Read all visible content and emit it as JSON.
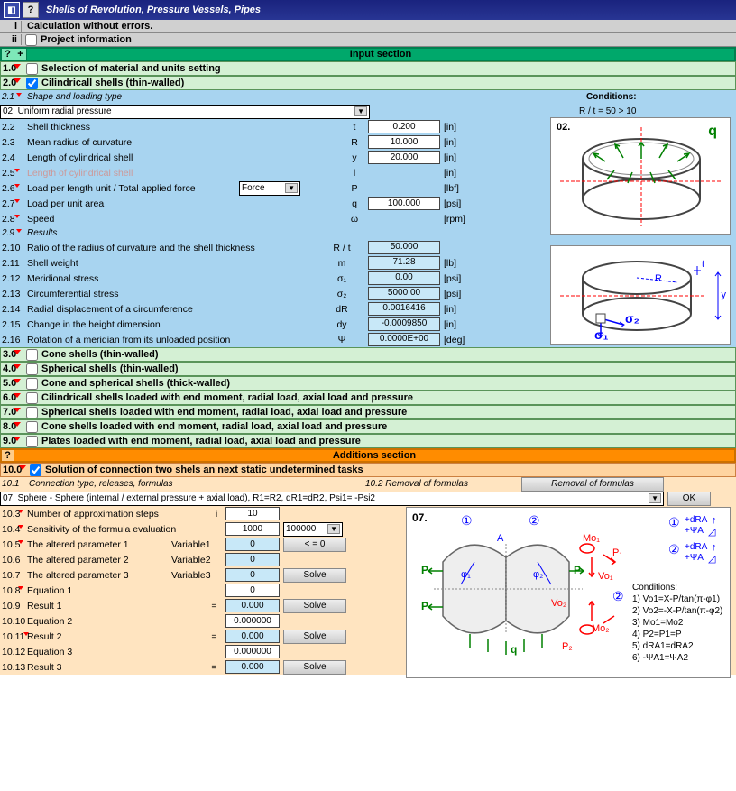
{
  "title": "Shells of Revolution, Pressure Vessels, Pipes",
  "status": {
    "i": "i",
    "i_text": "Calculation without errors.",
    "ii": "ii",
    "ii_text": "Project information"
  },
  "input_section": {
    "q": "?",
    "plus": "+",
    "title": "Input section"
  },
  "s1": {
    "num": "1.0",
    "label": "Selection of material and units setting"
  },
  "s2": {
    "num": "2.0",
    "label": "Cilindricall shells (thin-walled)",
    "r2_1": {
      "num": "2.1",
      "label": "Shape and loading type"
    },
    "conditions_label": "Conditions:",
    "conditions_text": "R / t = 50 > 10",
    "diagram_num": "02.",
    "diagram_q": "q",
    "dropdown": "02. Uniform radial pressure",
    "r2_2": {
      "num": "2.2",
      "label": "Shell thickness",
      "sym": "t",
      "val": "0.200",
      "unit": "[in]"
    },
    "r2_3": {
      "num": "2.3",
      "label": "Mean radius of curvature",
      "sym": "R",
      "val": "10.000",
      "unit": "[in]"
    },
    "r2_4": {
      "num": "2.4",
      "label": "Length of cylindrical shell",
      "sym": "y",
      "val": "20.000",
      "unit": "[in]"
    },
    "r2_5": {
      "num": "2.5",
      "label": "Length of cylindrical shell",
      "sym": "l",
      "unit": "[in]"
    },
    "r2_6": {
      "num": "2.6",
      "label": "Load per length unit / Total applied force",
      "dd": "Force",
      "sym": "P",
      "unit": "[lbf]"
    },
    "r2_7": {
      "num": "2.7",
      "label": "Load per unit area",
      "sym": "q",
      "val": "100.000",
      "unit": "[psi]"
    },
    "r2_8": {
      "num": "2.8",
      "label": "Speed",
      "sym": "ω",
      "unit": "[rpm]"
    },
    "r2_9": {
      "num": "2.9",
      "label": "Results"
    },
    "r2_10": {
      "num": "2.10",
      "label": "Ratio of the radius of curvature and the shell thickness",
      "sym": "R / t",
      "val": "50.000"
    },
    "r2_11": {
      "num": "2.11",
      "label": "Shell weight",
      "sym": "m",
      "val": "71.28",
      "unit": "[lb]"
    },
    "r2_12": {
      "num": "2.12",
      "label": "Meridional stress",
      "sym": "σ₁",
      "val": "0.00",
      "unit": "[psi]"
    },
    "r2_13": {
      "num": "2.13",
      "label": "Circumferential stress",
      "sym": "σ₂",
      "val": "5000.00",
      "unit": "[psi]"
    },
    "r2_14": {
      "num": "2.14",
      "label": "Radial displacement of a circumference",
      "sym": "dR",
      "val": "0.0016416",
      "unit": "[in]"
    },
    "r2_15": {
      "num": "2.15",
      "label": "Change in the height dimension",
      "sym": "dy",
      "val": "-0.0009850",
      "unit": "[in]"
    },
    "r2_16": {
      "num": "2.16",
      "label": "Rotation of a meridian from its unloaded position",
      "sym": "Ψ",
      "val": "0.0000E+00",
      "unit": "[deg]"
    },
    "diag2_sigma1": "σ₁",
    "diag2_sigma2": "σ₂",
    "diag2_t": "t",
    "diag2_R": "R",
    "diag2_y": "y"
  },
  "s3": {
    "num": "3.0",
    "label": "Cone shells (thin-walled)"
  },
  "s4": {
    "num": "4.0",
    "label": "Spherical shells (thin-walled)"
  },
  "s5": {
    "num": "5.0",
    "label": "Cone and spherical shells (thick-walled)"
  },
  "s6": {
    "num": "6.0",
    "label": "Cilindricall shells loaded with end moment, radial load, axial load and pressure"
  },
  "s7": {
    "num": "7.0",
    "label": "Spherical shells loaded with end moment, radial load, axial load and pressure"
  },
  "s8": {
    "num": "8.0",
    "label": "Cone shells loaded with end moment, radial load, axial load and pressure"
  },
  "s9": {
    "num": "9.0",
    "label": "Plates loaded with end moment, radial load, axial load and pressure"
  },
  "additions_section": {
    "q": "?",
    "title": "Additions section"
  },
  "s10": {
    "num": "10.0",
    "label": "Solution of connection two shels an next static undetermined tasks",
    "r10_1": {
      "num": "10.1",
      "label": "Connection type, releases, formulas"
    },
    "r10_2": {
      "num": "10.2",
      "label": "Removal of formulas"
    },
    "btn_removal": "Removal  of formulas",
    "dropdown": "07. Sphere - Sphere (internal / external pressure + axial load), R1=R2, dR1=dR2, Psi1= -Psi2",
    "btn_ok": "OK",
    "r10_3": {
      "num": "10.3",
      "label": "Number of approximation steps",
      "sym": "i",
      "val": "10"
    },
    "r10_4": {
      "num": "10.4",
      "label": "Sensitivity of the formula evaluation",
      "val": "1000",
      "dd": "100000"
    },
    "r10_5": {
      "num": "10.5",
      "label": "The altered parameter 1",
      "sym": "Variable1",
      "val": "0",
      "btn": "< = 0"
    },
    "r10_6": {
      "num": "10.6",
      "label": "The altered parameter 2",
      "sym": "Variable2",
      "val": "0"
    },
    "r10_7": {
      "num": "10.7",
      "label": "The altered parameter 3",
      "sym": "Variable3",
      "val": "0",
      "btn": "Solve"
    },
    "r10_8": {
      "num": "10.8",
      "label": "Equation 1",
      "val": "0"
    },
    "r10_9": {
      "num": "10.9",
      "label": "Result 1",
      "sym": "=",
      "val": "0.000",
      "btn": "Solve"
    },
    "r10_10": {
      "num": "10.10",
      "label": "Equation 2",
      "val": "0.000000"
    },
    "r10_11": {
      "num": "10.11",
      "label": "Result 2",
      "sym": "=",
      "val": "0.000",
      "btn": "Solve"
    },
    "r10_12": {
      "num": "10.12",
      "label": "Equation 3",
      "val": "0.000000"
    },
    "r10_13": {
      "num": "10.13",
      "label": "Result 3",
      "sym": "=",
      "val": "0.000",
      "btn": "Solve"
    },
    "diagram_num": "07.",
    "d_c1": "①",
    "d_c2": "②",
    "d_A": "A",
    "d_Mo1": "Mo₁",
    "d_P1": "P₁",
    "d_Vo1": "Vo₁",
    "d_Mo2": "Mo₂",
    "d_P2": "P₂",
    "d_Vo2": "Vo₂",
    "d_P": "P",
    "d_q": "q",
    "d_phi1": "φ₁",
    "d_phi2": "φ₂",
    "d_dRA": "+dRA",
    "d_psiA": "+ΨA",
    "cond_title": "Conditions:",
    "cond1": "1) Vo1=X-P/tan(π-φ1)",
    "cond2": "2) Vo2=-X-P/tan(π-φ2)",
    "cond3": "3) Mo1=Mo2",
    "cond4": "4) P2=P1=P",
    "cond5": "5) dRA1=dRA2",
    "cond6": "6) -ΨA1=ΨA2"
  }
}
